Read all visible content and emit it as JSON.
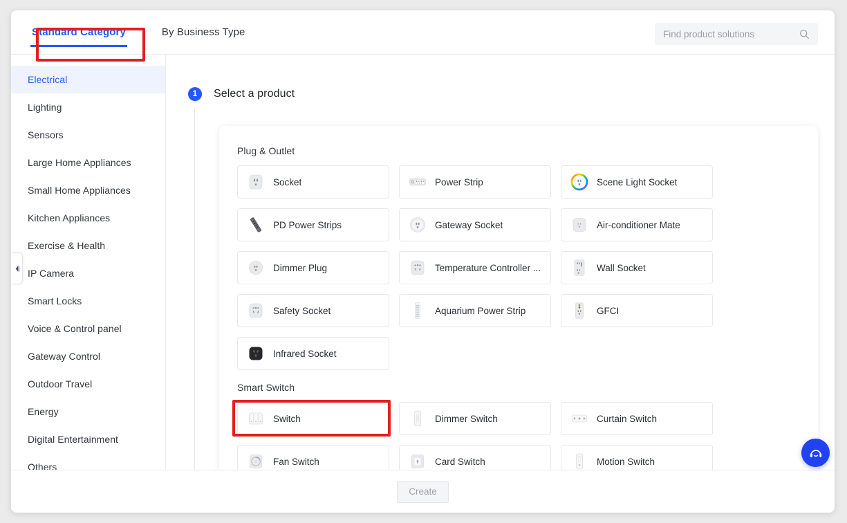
{
  "header": {
    "tabs": [
      {
        "label": "Standard Category",
        "active": true
      },
      {
        "label": "By Business Type",
        "active": false
      }
    ],
    "search": {
      "placeholder": "Find product solutions",
      "value": "",
      "icon": "search-icon"
    }
  },
  "sidebar": {
    "items": [
      {
        "label": "Electrical",
        "active": true
      },
      {
        "label": "Lighting",
        "active": false
      },
      {
        "label": "Sensors",
        "active": false
      },
      {
        "label": "Large Home Appliances",
        "active": false
      },
      {
        "label": "Small Home Appliances",
        "active": false
      },
      {
        "label": "Kitchen Appliances",
        "active": false
      },
      {
        "label": "Exercise & Health",
        "active": false
      },
      {
        "label": "IP Camera",
        "active": false
      },
      {
        "label": "Smart Locks",
        "active": false
      },
      {
        "label": "Voice & Control panel",
        "active": false
      },
      {
        "label": "Gateway Control",
        "active": false
      },
      {
        "label": "Outdoor Travel",
        "active": false
      },
      {
        "label": "Energy",
        "active": false
      },
      {
        "label": "Digital Entertainment",
        "active": false
      },
      {
        "label": "Others",
        "active": false
      }
    ],
    "collapse_icon": "chevron-left-icon"
  },
  "main": {
    "step": {
      "number": "1",
      "title": "Select a product"
    },
    "groups": [
      {
        "title": "Plug & Outlet",
        "products": [
          {
            "label": "Socket",
            "icon": "socket-icon",
            "selected": false
          },
          {
            "label": "Power Strip",
            "icon": "power-strip-icon",
            "selected": false
          },
          {
            "label": "Scene Light Socket",
            "icon": "scene-light-socket-icon",
            "selected": false
          },
          {
            "label": "PD Power Strips",
            "icon": "pd-power-strip-icon",
            "selected": false
          },
          {
            "label": "Gateway Socket",
            "icon": "gateway-socket-icon",
            "selected": false
          },
          {
            "label": "Air-conditioner Mate",
            "icon": "air-conditioner-mate-icon",
            "selected": false
          },
          {
            "label": "Dimmer Plug",
            "icon": "dimmer-plug-icon",
            "selected": false
          },
          {
            "label": "Temperature Controller ...",
            "icon": "temperature-controller-icon",
            "selected": false
          },
          {
            "label": "Wall Socket",
            "icon": "wall-socket-icon",
            "selected": false
          },
          {
            "label": "Safety Socket",
            "icon": "safety-socket-icon",
            "selected": false
          },
          {
            "label": "Aquarium Power Strip",
            "icon": "aquarium-power-strip-icon",
            "selected": false
          },
          {
            "label": "GFCI",
            "icon": "gfci-icon",
            "selected": false
          },
          {
            "label": "Infrared Socket",
            "icon": "infrared-socket-icon",
            "selected": false
          }
        ]
      },
      {
        "title": "Smart Switch",
        "products": [
          {
            "label": "Switch",
            "icon": "switch-icon",
            "selected": true
          },
          {
            "label": "Dimmer Switch",
            "icon": "dimmer-switch-icon",
            "selected": false
          },
          {
            "label": "Curtain Switch",
            "icon": "curtain-switch-icon",
            "selected": false
          },
          {
            "label": "Fan Switch",
            "icon": "fan-switch-icon",
            "selected": false
          },
          {
            "label": "Card Switch",
            "icon": "card-switch-icon",
            "selected": false
          },
          {
            "label": "Motion Switch",
            "icon": "motion-switch-icon",
            "selected": false
          }
        ]
      }
    ]
  },
  "footer": {
    "create_label": "Create",
    "create_disabled": true
  },
  "support": {
    "icon": "headset-chat-icon"
  },
  "annotations": [
    {
      "target": "Standard Category tab",
      "color": "#e02020"
    },
    {
      "target": "Switch product card",
      "color": "#e02020"
    }
  ]
}
